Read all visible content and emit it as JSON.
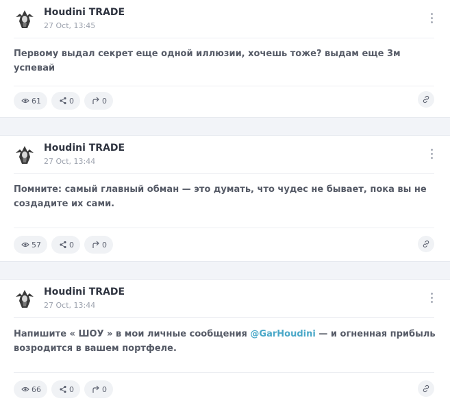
{
  "posts": [
    {
      "author": "Houdini TRADE",
      "date": "27 Oct, 13:45",
      "text": "Первому выдал секрет еще одной иллюзии, хочешь тоже? выдам еще 3м успевай",
      "views": "61",
      "shares": "0",
      "forwards": "0"
    },
    {
      "author": "Houdini TRADE",
      "date": "27 Oct, 13:44",
      "text": "Помните: самый главный обман — это думать, что чудес не бывает, пока вы не создадите их сами.",
      "views": "57",
      "shares": "0",
      "forwards": "0"
    },
    {
      "author": "Houdini TRADE",
      "date": "27 Oct, 13:44",
      "text_before": "Напишите « ШОУ » в мои личные сообщения ",
      "mention": "@GarHoudini",
      "text_after": " — и огненная прибыль возродится в вашем портфеле.",
      "views": "66",
      "shares": "0",
      "forwards": "0"
    }
  ],
  "icons": {
    "avatar": "hooded-figure-avatar",
    "views": "eye-icon",
    "shares": "share-icon",
    "forwards": "forward-arrow-icon",
    "link": "link-icon",
    "menu": "kebab-menu-icon"
  }
}
